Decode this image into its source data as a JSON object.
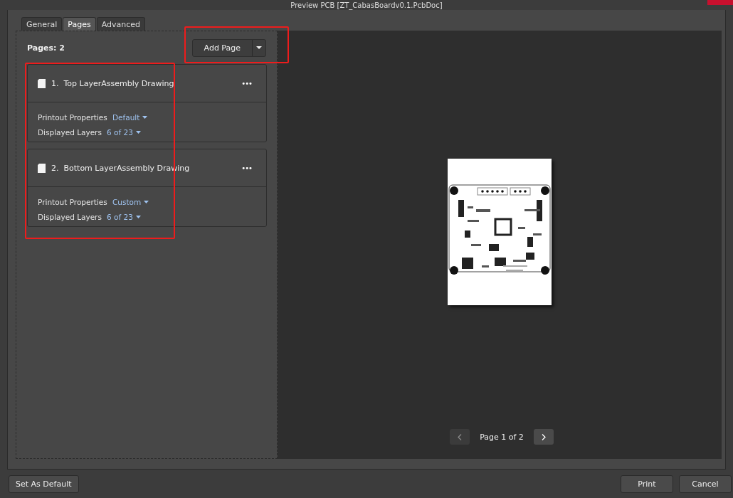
{
  "window": {
    "title": "Preview PCB [ZT_CabasBoardv0.1.PcbDoc]"
  },
  "tabs": [
    {
      "label": "General",
      "selected": false
    },
    {
      "label": "Pages",
      "selected": true
    },
    {
      "label": "Advanced",
      "selected": false
    }
  ],
  "pages_panel": {
    "count_label": "Pages: 2",
    "add_button": "Add Page",
    "pages": [
      {
        "number": "1.",
        "title": "Top LayerAssembly Drawing",
        "menu": "•••",
        "properties": [
          {
            "label": "Printout Properties",
            "value": "Default"
          },
          {
            "label": "Displayed Layers",
            "value": "6 of 23"
          }
        ]
      },
      {
        "number": "2.",
        "title": "Bottom LayerAssembly Drawing",
        "menu": "•••",
        "properties": [
          {
            "label": "Printout Properties",
            "value": "Custom"
          },
          {
            "label": "Displayed Layers",
            "value": "6 of 23"
          }
        ]
      }
    ]
  },
  "preview": {
    "page_label": "Page 1 of 2",
    "prev_disabled": true,
    "next_disabled": false
  },
  "footer": {
    "buttons": [
      {
        "label": "Set As Default"
      },
      {
        "label": "Print"
      },
      {
        "label": "Cancel"
      }
    ]
  }
}
